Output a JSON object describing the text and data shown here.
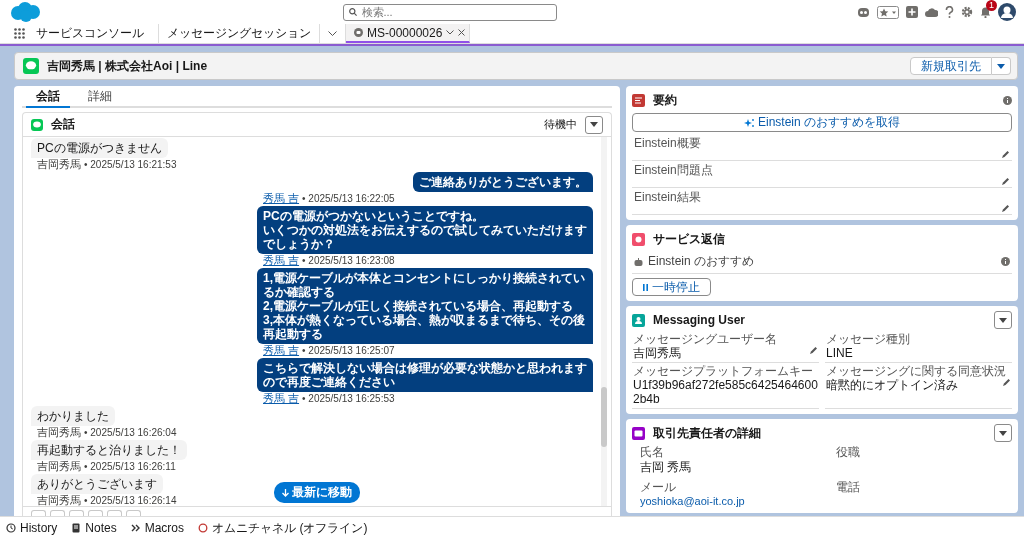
{
  "global_header": {
    "search": {
      "placeholder": "検索..."
    },
    "notification_badge": "1"
  },
  "nav": {
    "app_name": "サービスコンソール",
    "tabs": [
      {
        "label": "メッセージングセッション",
        "kind": "object",
        "selected": false
      },
      {
        "label": "MS-00000026",
        "kind": "record",
        "selected": true
      }
    ]
  },
  "record_header": {
    "title": "吉岡秀馬 | 株式会社Aoi | Line",
    "action": "新規取引先"
  },
  "tabs": [
    {
      "label": "会話",
      "selected": true
    },
    {
      "label": "詳細",
      "selected": false
    }
  ],
  "conversation": {
    "title": "会話",
    "status": "待機中",
    "jump_button": "最新に移動",
    "messages": [
      {
        "kind": "inbound",
        "lines": [
          "PCの電源がつきません"
        ],
        "author": "吉岡秀馬",
        "time": "• 2025/5/13 16:21:53"
      },
      {
        "kind": "outbound",
        "lines": [
          "ご連絡ありがとうございます。"
        ],
        "author": "秀馬 吉",
        "time": "• 2025/5/13 16:22:05"
      },
      {
        "kind": "outbound",
        "lines": [
          "PCの電源がつかないということですね。",
          "いくつかの対処法をお伝えするので試してみていただけますでしょうか？"
        ],
        "author": "秀馬 吉",
        "time": "• 2025/5/13 16:23:08"
      },
      {
        "kind": "outbound",
        "lines": [
          "1,電源ケーブルが本体とコンセントにしっかり接続されているか確認する",
          "2,電源ケーブルが正しく接続されている場合、再起動する",
          "3,本体が熱くなっている場合、熱が収まるまで待ち、その後再起動する"
        ],
        "author": "秀馬 吉",
        "time": "• 2025/5/13 16:25:07"
      },
      {
        "kind": "outbound",
        "lines": [
          "こちらで解決しない場合は修理が必要な状態かと思われますので再度ご連絡ください"
        ],
        "author": "秀馬 吉",
        "time": "• 2025/5/13 16:25:53"
      },
      {
        "kind": "inbound",
        "lines": [
          "わかりました"
        ],
        "author": "吉岡秀馬",
        "time": "• 2025/5/13 16:26:04"
      },
      {
        "kind": "inbound",
        "lines": [
          "再起動すると治りました！"
        ],
        "author": "吉岡秀馬",
        "time": "• 2025/5/13 16:26:11"
      },
      {
        "kind": "inbound",
        "lines": [
          "ありがとうございます"
        ],
        "author": "吉岡秀馬",
        "time": "• 2025/5/13 16:26:14"
      }
    ]
  },
  "summary": {
    "title": "要約",
    "einstein_button": "Einstein のおすすめを取得",
    "fields": [
      {
        "label": "Einstein概要",
        "editable": true
      },
      {
        "label": "Einstein問題点",
        "editable": true
      },
      {
        "label": "Einstein結果",
        "editable": true
      }
    ]
  },
  "service_replies": {
    "title": "サービス返信",
    "recommendation": "Einstein のおすすめ",
    "pause_button": "一時停止"
  },
  "messaging_user": {
    "title": "Messaging User",
    "fields": [
      {
        "label": "メッセージングユーザー名",
        "value": "吉岡秀馬",
        "editable": true
      },
      {
        "label": "メッセージ種別",
        "value": "LINE",
        "editable": false
      },
      {
        "label": "メッセージプラットフォームキー",
        "value": "U1f39b96af272fe585c64254646002b4b",
        "editable": false
      },
      {
        "label": "メッセージングに関する同意状況",
        "value": "暗黙的にオプトイン済み",
        "editable": true
      }
    ]
  },
  "contact": {
    "title": "取引先責任者の詳細",
    "fields": [
      {
        "label": "氏名",
        "value": "吉岡 秀馬",
        "kind": "text"
      },
      {
        "label": "役職",
        "kind": "text"
      },
      {
        "label": "メール",
        "value": "yoshioka@aoi-it.co.jp",
        "kind": "link"
      },
      {
        "label": "電話",
        "kind": "text"
      }
    ]
  },
  "utility_bar": [
    {
      "label": "History",
      "kind": "history"
    },
    {
      "label": "Notes",
      "kind": "notes"
    },
    {
      "label": "Macros",
      "kind": "macros"
    },
    {
      "label": "オムニチャネル (オフライン)",
      "kind": "omni"
    }
  ]
}
